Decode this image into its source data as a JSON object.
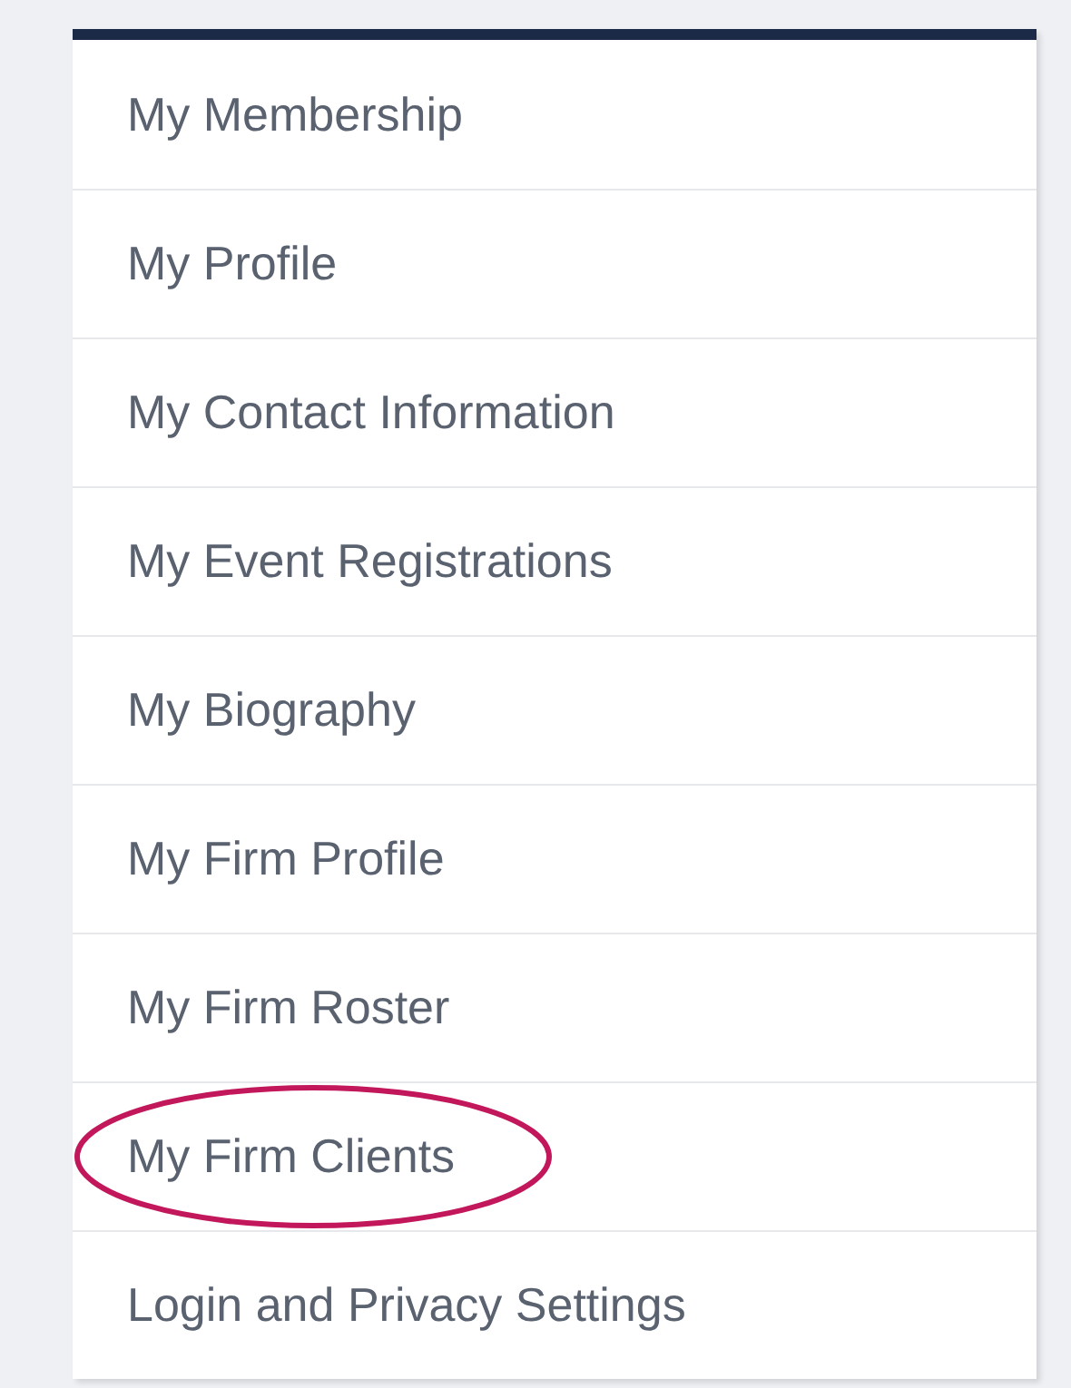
{
  "menu": {
    "items": [
      {
        "label": "My Membership",
        "circled": false
      },
      {
        "label": "My Profile",
        "circled": false
      },
      {
        "label": "My Contact Information",
        "circled": false
      },
      {
        "label": "My Event Registrations",
        "circled": false
      },
      {
        "label": "My Biography",
        "circled": false
      },
      {
        "label": "My Firm Profile",
        "circled": false
      },
      {
        "label": "My Firm Roster",
        "circled": false
      },
      {
        "label": "My Firm Clients",
        "circled": true
      },
      {
        "label": "Login and Privacy Settings",
        "circled": false
      }
    ]
  }
}
